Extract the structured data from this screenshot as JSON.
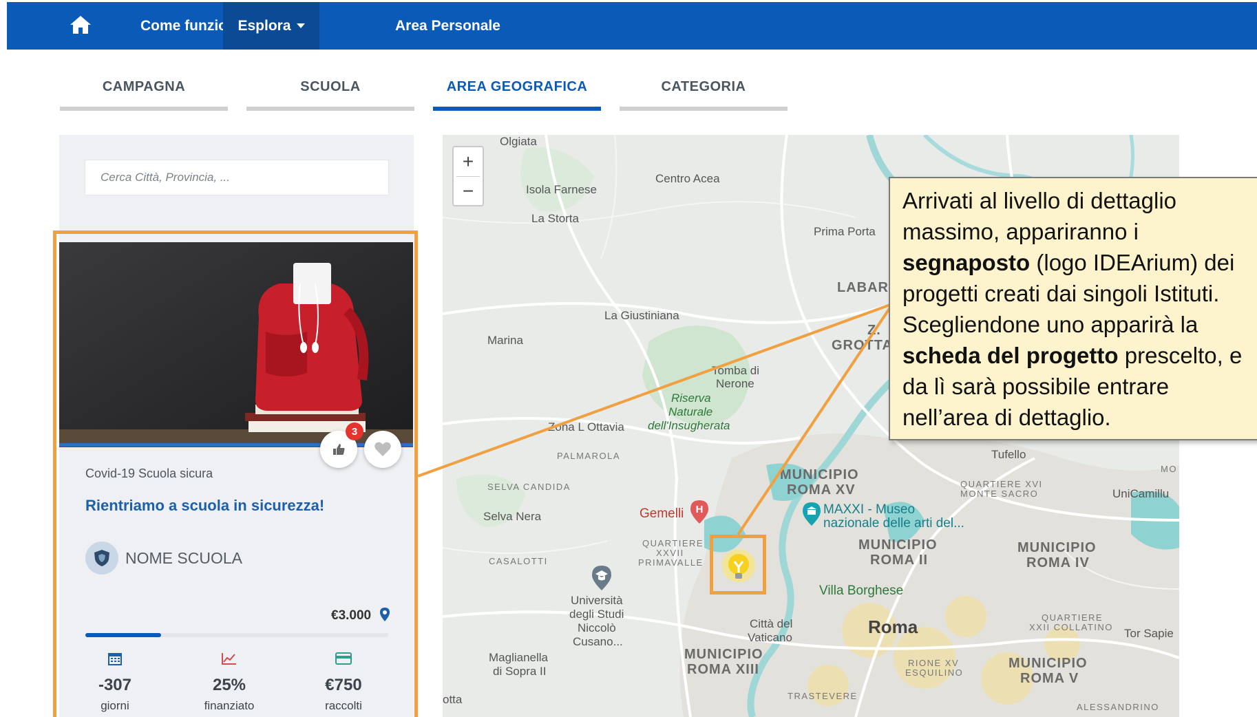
{
  "navbar": {
    "home_icon": "home-icon",
    "items": [
      {
        "label": "Come funziona"
      },
      {
        "label": "Esplora",
        "active": true
      },
      {
        "label": "Area Personale"
      }
    ]
  },
  "tabs": [
    {
      "label": "CAMPAGNA"
    },
    {
      "label": "SCUOLA"
    },
    {
      "label": "AREA GEOGRAFICA",
      "active": true
    },
    {
      "label": "CATEGORIA"
    }
  ],
  "search": {
    "placeholder": "Cerca Città, Provincia, ..."
  },
  "card": {
    "likes_count": "3",
    "category": "Covid-19 Scuola sicura",
    "title": "Rientriamo a scuola in sicurezza!",
    "school_name": "NOME SCUOLA",
    "goal_amount": "€3.000",
    "progress_percent": 25,
    "stats": [
      {
        "icon": "calendar-icon",
        "value": "-307",
        "label": "giorni"
      },
      {
        "icon": "chart-up-icon",
        "value": "25%",
        "label": "finanziato"
      },
      {
        "icon": "card-icon",
        "value": "€750",
        "label": "raccolti"
      }
    ]
  },
  "map": {
    "zoom_in": "+",
    "zoom_out": "−",
    "labels": {
      "olgiata": "Olgiata",
      "centro_acea": "Centro Acea",
      "isola_farnese": "Isola Farnese",
      "la_storta": "La Storta",
      "prima_porta": "Prima Porta",
      "labaro": "LABAR",
      "la_giustiniana": "La Giustiniana",
      "marina": "Marina",
      "z": "Z.",
      "grotta": "GROTTA",
      "tomba_di": "Tomba di",
      "nerone": "Nerone",
      "riserva": "Riserva",
      "naturale": "Naturale",
      "insugherata": "dell'Insugherata",
      "zona_ottavia": "Zona L Ottavia",
      "palmarola": "PALMAROLA",
      "tufello": "Tufello",
      "mo": "MO",
      "selva_candida": "SELVA CANDIDA",
      "municipio_xv_1": "MUNICIPIO",
      "municipio_xv_2": "ROMA XV",
      "quartiere_xvi_1": "QUARTIERE XVI",
      "quartiere_xvi_2": "MONTE SACRO",
      "unicamillus": "UniCamillu",
      "selva_nera": "Selva Nera",
      "gemelli": "Gemelli",
      "maxxi_1": "MAXXI - Museo",
      "maxxi_2": "nazionale delle arti del...",
      "q27_1": "QUARTIERE",
      "q27_2": "XXVII",
      "q27_3": "PRIMAVALLE",
      "casalotti": "CASALOTTI",
      "municipio_ii_1": "MUNICIPIO",
      "municipio_ii_2": "ROMA II",
      "municipio_iv_1": "MUNICIPIO",
      "municipio_iv_2": "ROMA IV",
      "villa_borghese": "Villa Borghese",
      "universita_1": "Università",
      "universita_2": "degli Studi",
      "universita_3": "Niccolò",
      "universita_4": "Cusano...",
      "citta_vaticano_1": "Città del",
      "citta_vaticano_2": "Vaticano",
      "roma": "Roma",
      "q22_1": "QUARTIERE",
      "q22_2": "XXII COLLATINO",
      "tor_sapie": "Tor Sapie",
      "magliana_1": "Maglianella",
      "magliana_2": "di Sopra II",
      "municipio_xiii_1": "MUNICIPIO",
      "municipio_xiii_2": "ROMA XIII",
      "rione_xv_1": "RIONE XV",
      "rione_xv_2": "ESQUILINO",
      "municipio_v_1": "MUNICIPIO",
      "municipio_v_2": "ROMA V",
      "otta": "otta",
      "trastevere": "TRASTEVERE",
      "alessandrino": "ALESSANDRINO"
    }
  },
  "callout": {
    "t1": "Arrivati al livello di dettaglio massimo, appariranno i ",
    "b1": "segnaposto",
    "t2": " (logo IDEArium) dei progetti creati dai singoli Istituti. Scegliendone uno apparirà la ",
    "b2": "scheda del progetto",
    "t3": " prescelto, e da lì sarà possibile entrare nell’area di dettaglio."
  },
  "colors": {
    "nav_bg": "#0a5bb8",
    "nav_active": "#0b4a94",
    "highlight": "#f0a040",
    "callout_bg": "#fdf3cc",
    "badge": "#e5342f"
  }
}
